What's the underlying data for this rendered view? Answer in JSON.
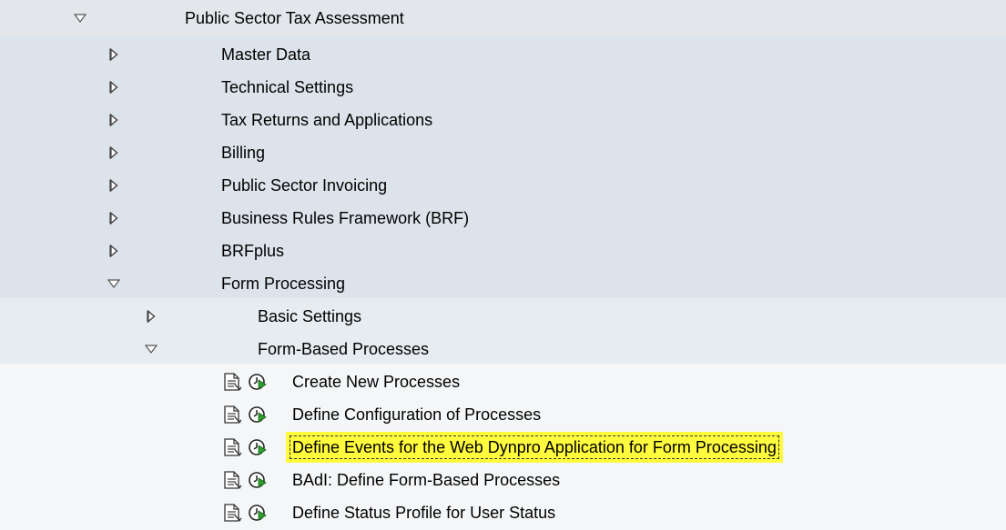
{
  "tree": {
    "root": {
      "label": "Public Sector Tax Assessment",
      "expanded": true
    },
    "level1": [
      {
        "label": "Master Data",
        "expanded": false
      },
      {
        "label": "Technical Settings",
        "expanded": false
      },
      {
        "label": "Tax Returns and Applications",
        "expanded": false
      },
      {
        "label": "Billing",
        "expanded": false
      },
      {
        "label": "Public Sector Invoicing",
        "expanded": false
      },
      {
        "label": "Business Rules Framework (BRF)",
        "expanded": false
      },
      {
        "label": "BRFplus",
        "expanded": false
      },
      {
        "label": "Form Processing",
        "expanded": true
      }
    ],
    "level2": [
      {
        "label": "Basic Settings",
        "expanded": false
      },
      {
        "label": "Form-Based Processes",
        "expanded": true
      }
    ],
    "activities": [
      {
        "label": "Create New Processes",
        "selected": false
      },
      {
        "label": "Define Configuration of Processes",
        "selected": false
      },
      {
        "label": "Define Events for the Web Dynpro Application for Form Processing",
        "selected": true
      },
      {
        "label": "BAdI: Define Form-Based Processes",
        "selected": false
      },
      {
        "label": "Define Status Profile for User Status",
        "selected": false
      }
    ]
  },
  "icons": {
    "expanded": "triangle-down-icon",
    "collapsed": "triangle-right-icon",
    "documentation": "document-icon",
    "execute": "execute-clock-icon"
  },
  "colors": {
    "highlight": "#fffb3d",
    "execute_green": "#2f9e2f"
  }
}
